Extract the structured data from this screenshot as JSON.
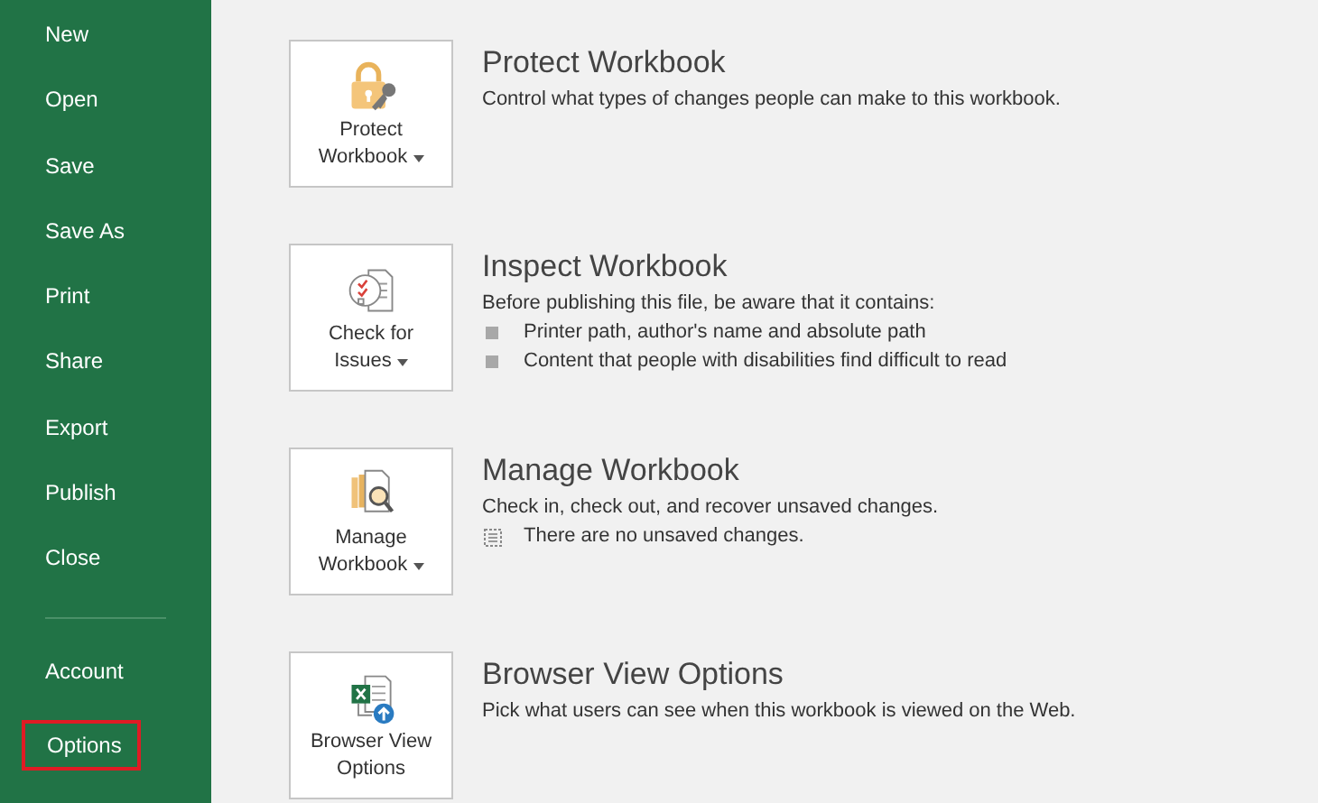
{
  "sidebar": {
    "items": [
      {
        "label": "New",
        "highlighted": false
      },
      {
        "label": "Open",
        "highlighted": false
      },
      {
        "label": "Save",
        "highlighted": false
      },
      {
        "label": "Save As",
        "highlighted": false
      },
      {
        "label": "Print",
        "highlighted": false
      },
      {
        "label": "Share",
        "highlighted": false
      },
      {
        "label": "Export",
        "highlighted": false
      },
      {
        "label": "Publish",
        "highlighted": false
      },
      {
        "label": "Close",
        "highlighted": false
      }
    ],
    "bottom_items": [
      {
        "label": "Account",
        "highlighted": false
      },
      {
        "label": "Options",
        "highlighted": true
      }
    ]
  },
  "sections": [
    {
      "kind": "protect",
      "button": {
        "lines": [
          "Protect",
          "Workbook"
        ],
        "dropdown": true
      },
      "title": "Protect Workbook",
      "description": "Control what types of changes people can make to this workbook."
    },
    {
      "kind": "inspect",
      "button": {
        "lines": [
          "Check for",
          "Issues"
        ],
        "dropdown": true
      },
      "title": "Inspect Workbook",
      "description": "Before publishing this file, be aware that it contains:",
      "details": [
        {
          "kind": "bullet",
          "text": "Printer path, author's name and absolute path"
        },
        {
          "kind": "bullet",
          "text": "Content that people with disabilities find difficult to read"
        }
      ]
    },
    {
      "kind": "manage",
      "button": {
        "lines": [
          "Manage",
          "Workbook"
        ],
        "dropdown": true
      },
      "title": "Manage Workbook",
      "description": "Check in, check out, and recover unsaved changes.",
      "details": [
        {
          "kind": "note",
          "text": "There are no unsaved changes."
        }
      ]
    },
    {
      "kind": "browser",
      "button": {
        "lines": [
          "Browser View",
          "Options"
        ],
        "dropdown": false
      },
      "title": "Browser View Options",
      "description": "Pick what users can see when this workbook is viewed on the Web."
    }
  ]
}
